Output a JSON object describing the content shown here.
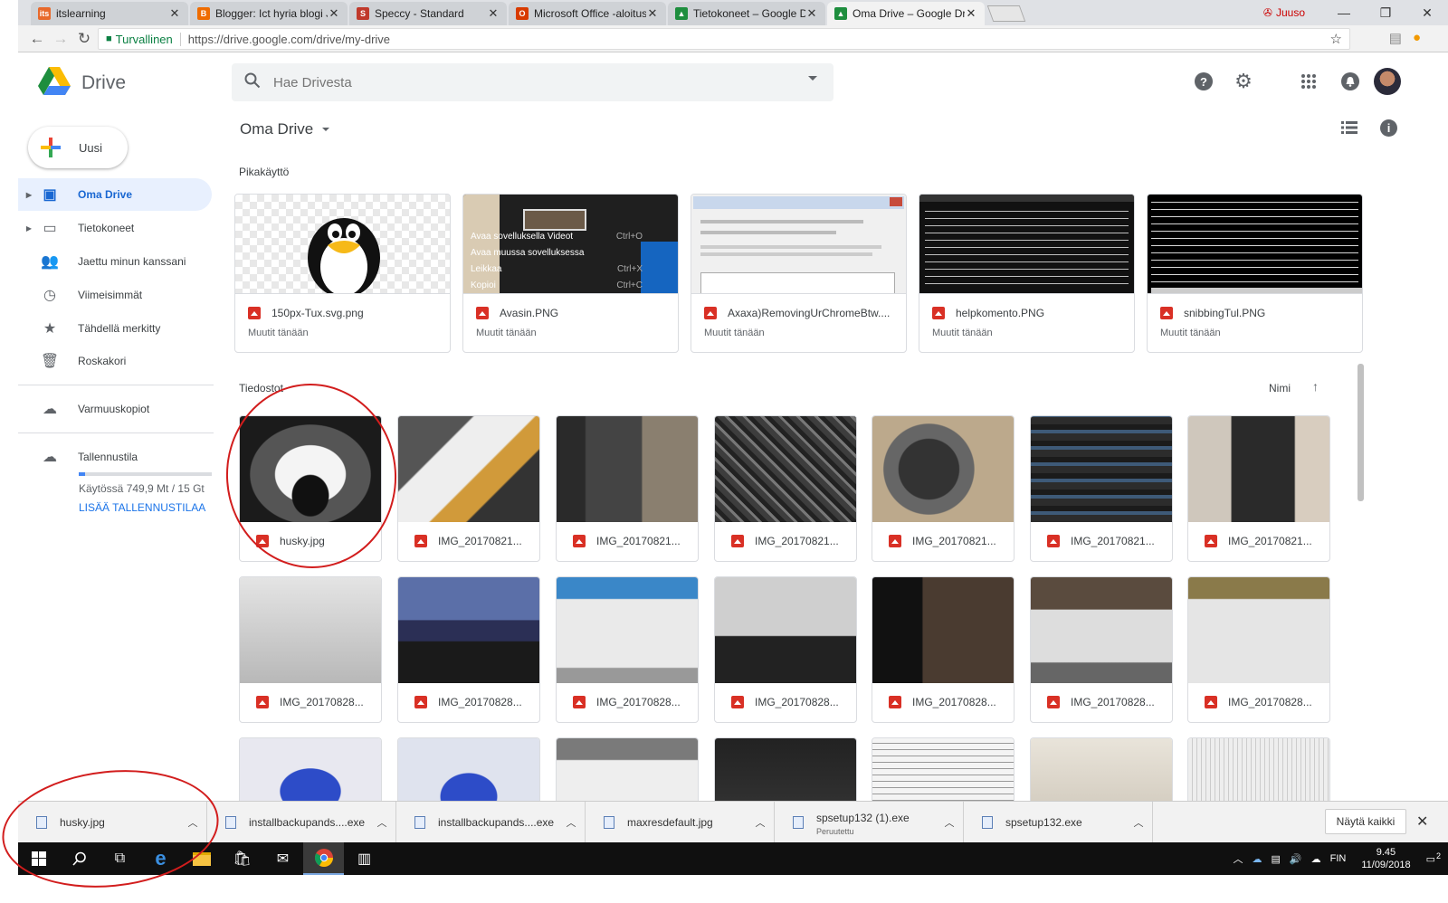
{
  "browser": {
    "tabs": [
      {
        "label": "itslearning",
        "fav": "its",
        "fav_color": "#e8692b"
      },
      {
        "label": "Blogger: Ict hyria blogi Ju",
        "fav": "B",
        "fav_color": "#ef6c00"
      },
      {
        "label": "Speccy - Standard",
        "fav": "S",
        "fav_color": "#c0392b"
      },
      {
        "label": "Microsoft Office -aloitus",
        "fav": "O",
        "fav_color": "#d83b01"
      },
      {
        "label": "Tietokoneet – Google Dri",
        "fav": "▲",
        "fav_color": "#1e8e3e"
      },
      {
        "label": "Oma Drive – Google Drive",
        "fav": "▲",
        "fav_color": "#1e8e3e"
      }
    ],
    "user": "Juuso",
    "secure_label": "Turvallinen",
    "url": "https://drive.google.com/drive/my-drive"
  },
  "header": {
    "app_name": "Drive",
    "search_placeholder": "Hae Drivesta"
  },
  "sidebar": {
    "new_label": "Uusi",
    "items": [
      {
        "label": "Oma Drive",
        "icon": "drive-icon"
      },
      {
        "label": "Tietokoneet",
        "icon": "computers-icon"
      },
      {
        "label": "Jaettu minun kanssani",
        "icon": "shared-icon"
      },
      {
        "label": "Viimeisimmät",
        "icon": "clock-icon"
      },
      {
        "label": "Tähdellä merkitty",
        "icon": "star-icon"
      },
      {
        "label": "Roskakori",
        "icon": "trash-icon"
      },
      {
        "label": "Varmuuskopiot",
        "icon": "cloud-icon"
      },
      {
        "label": "Tallennustila",
        "icon": "cloud-outline-icon"
      }
    ],
    "storage_used_fraction": 0.05,
    "storage_text": "Käytössä 749,9 Mt / 15 Gt",
    "storage_link": "LISÄÄ TALLENNUSTILAA"
  },
  "main": {
    "breadcrumb": "Oma Drive",
    "quick_access_label": "Pikakäyttö",
    "quick_access": [
      {
        "name": "150px-Tux.svg.png",
        "sub": "Muutit tänään"
      },
      {
        "name": "Avasin.PNG",
        "sub": "Muutit tänään"
      },
      {
        "name": "Axaxa)RemovingUrChromeBtw....",
        "sub": "Muutit tänään"
      },
      {
        "name": "helpkomento.PNG",
        "sub": "Muutit tänään"
      },
      {
        "name": "snibbingTul.PNG",
        "sub": "Muutit tänään"
      }
    ],
    "avasin_menu": [
      "Avaa sovelluksella Videot",
      "Avaa muussa sovelluksessa",
      "Leikkaa",
      "Kopioi"
    ],
    "avasin_shortcuts": [
      "Ctrl+O",
      "Ctrl+X",
      "Ctrl+C"
    ],
    "files_label": "Tiedostot",
    "sort_label": "Nimi",
    "files": [
      {
        "name": "husky.jpg"
      },
      {
        "name": "IMG_20170821..."
      },
      {
        "name": "IMG_20170821..."
      },
      {
        "name": "IMG_20170821..."
      },
      {
        "name": "IMG_20170821..."
      },
      {
        "name": "IMG_20170821..."
      },
      {
        "name": "IMG_20170821..."
      },
      {
        "name": "IMG_20170828..."
      },
      {
        "name": "IMG_20170828..."
      },
      {
        "name": "IMG_20170828..."
      },
      {
        "name": "IMG_20170828..."
      },
      {
        "name": "IMG_20170828..."
      },
      {
        "name": "IMG_20170828..."
      },
      {
        "name": "IMG_20170828..."
      },
      {
        "name": ""
      },
      {
        "name": ""
      },
      {
        "name": ""
      },
      {
        "name": ""
      },
      {
        "name": ""
      },
      {
        "name": ""
      },
      {
        "name": ""
      }
    ]
  },
  "downloads": {
    "items": [
      {
        "name": "husky.jpg",
        "sub": ""
      },
      {
        "name": "installbackupands....exe",
        "sub": ""
      },
      {
        "name": "installbackupands....exe",
        "sub": ""
      },
      {
        "name": "maxresdefault.jpg",
        "sub": ""
      },
      {
        "name": "spsetup132 (1).exe",
        "sub": "Peruutettu"
      },
      {
        "name": "spsetup132.exe",
        "sub": ""
      }
    ],
    "show_all": "Näytä kaikki"
  },
  "taskbar": {
    "lang": "FIN",
    "time": "9.45",
    "date": "11/09/2018",
    "notif_count": "2"
  },
  "colors": {
    "accent": "#1967d2",
    "annotation": "#d21d1d"
  }
}
